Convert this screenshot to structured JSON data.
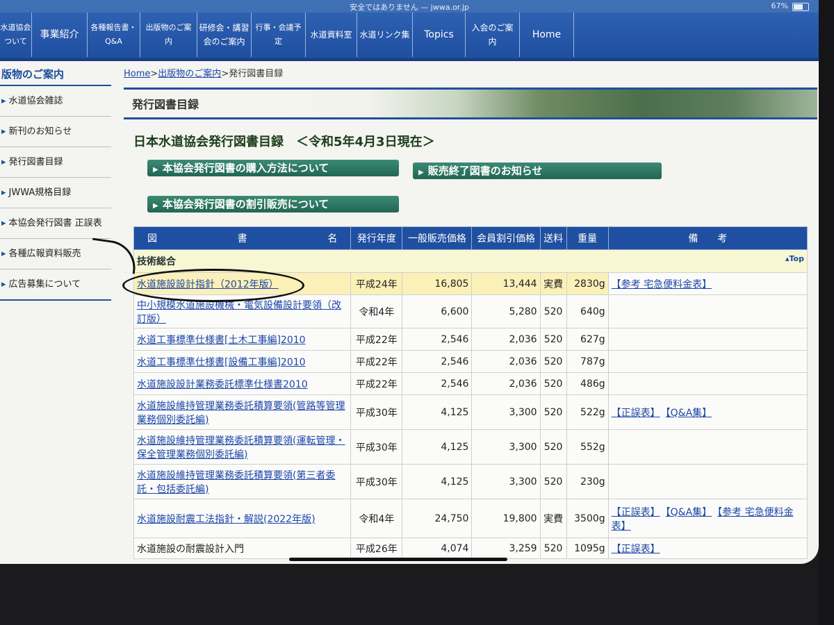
{
  "status": {
    "url": "安全ではありません — jwwa.or.jp",
    "battery": "67%"
  },
  "nav": [
    {
      "label": "水道協会\nついて"
    },
    {
      "label": "事業紹介"
    },
    {
      "label": "各種報告書・\nQ&A"
    },
    {
      "label": "出版物のご案内"
    },
    {
      "label": "研修会・講習\n会のご案内"
    },
    {
      "label": "行事・会議予定"
    },
    {
      "label": "水道資料室"
    },
    {
      "label": "水道リンク集"
    },
    {
      "label": "Topics"
    },
    {
      "label": "入会のご案内"
    },
    {
      "label": "Home"
    }
  ],
  "sidebar": {
    "title": "版物のご案内",
    "items": [
      "水道協会雑誌",
      "新刊のお知らせ",
      "発行図書目録",
      "JWWA規格目録",
      "本協会発行図書 正誤表",
      "各種広報資料販売",
      "広告募集について"
    ]
  },
  "breadcrumb": {
    "home": "Home",
    "sep1": ">",
    "pub": "出版物のご案内",
    "sep2": ">",
    "current": "発行図書目録"
  },
  "banner_title": "発行図書目録",
  "page_title": "日本水道協会発行図書目録　＜令和5年4月3日現在＞",
  "buttons": {
    "purchase": "本協会発行図書の購入方法について",
    "discontinued": "販売終了図書のお知らせ",
    "discount": "本協会発行図書の割引販売について"
  },
  "table": {
    "headers": {
      "name_1": "図",
      "name_2": "書",
      "name_3": "名",
      "year": "発行年度",
      "price": "一般販売価格",
      "member": "会員割引価格",
      "ship": "送料",
      "weight": "重量",
      "notes": "備　　考"
    },
    "category": "技術総合",
    "top_link": "Top",
    "rows": [
      {
        "name": "水道施設設計指針（2012年版）",
        "year": "平成24年",
        "price": "16,805",
        "member": "13,444",
        "ship": "実費",
        "weight": "2830g",
        "notes": [
          "【参考 宅急便料金表】"
        ]
      },
      {
        "name": "中小規模水道施設機械・電気設備設計要領（改訂版）",
        "year": "令和4年",
        "price": "6,600",
        "member": "5,280",
        "ship": "520",
        "weight": "640g",
        "notes": []
      },
      {
        "name": "水道工事標準仕様書[土木工事編]2010",
        "year": "平成22年",
        "price": "2,546",
        "member": "2,036",
        "ship": "520",
        "weight": "627g",
        "notes": []
      },
      {
        "name": "水道工事標準仕様書[設備工事編]2010",
        "year": "平成22年",
        "price": "2,546",
        "member": "2,036",
        "ship": "520",
        "weight": "787g",
        "notes": []
      },
      {
        "name": "水道施設設計業務委託標準仕様書2010",
        "year": "平成22年",
        "price": "2,546",
        "member": "2,036",
        "ship": "520",
        "weight": "486g",
        "notes": []
      },
      {
        "name": "水道施設維持管理業務委託積算要領(管路等管理業務個別委託編)",
        "year": "平成30年",
        "price": "4,125",
        "member": "3,300",
        "ship": "520",
        "weight": "522g",
        "notes": [
          "【正誤表】",
          "【Q&A集】"
        ]
      },
      {
        "name": "水道施設維持管理業務委託積算要領(運転管理・保全管理業務個別委託編)",
        "year": "平成30年",
        "price": "4,125",
        "member": "3,300",
        "ship": "520",
        "weight": "552g",
        "notes": []
      },
      {
        "name": "水道施設維持管理業務委託積算要領(第三者委託・包括委託編)",
        "year": "平成30年",
        "price": "4,125",
        "member": "3,300",
        "ship": "520",
        "weight": "230g",
        "notes": []
      },
      {
        "name": "水道施設耐震工法指針・解説(2022年版)",
        "year": "令和4年",
        "price": "24,750",
        "member": "19,800",
        "ship": "実費",
        "weight": "3500g",
        "notes": [
          "【正誤表】",
          "【Q&A集】",
          "【参考 宅急便料金表】"
        ]
      },
      {
        "name": "水道施設の耐震設計入門",
        "year": "平成26年",
        "price": "4,074",
        "member": "3,259",
        "ship": "520",
        "weight": "1095g",
        "notes": [
          "【正誤表】"
        ]
      }
    ]
  }
}
